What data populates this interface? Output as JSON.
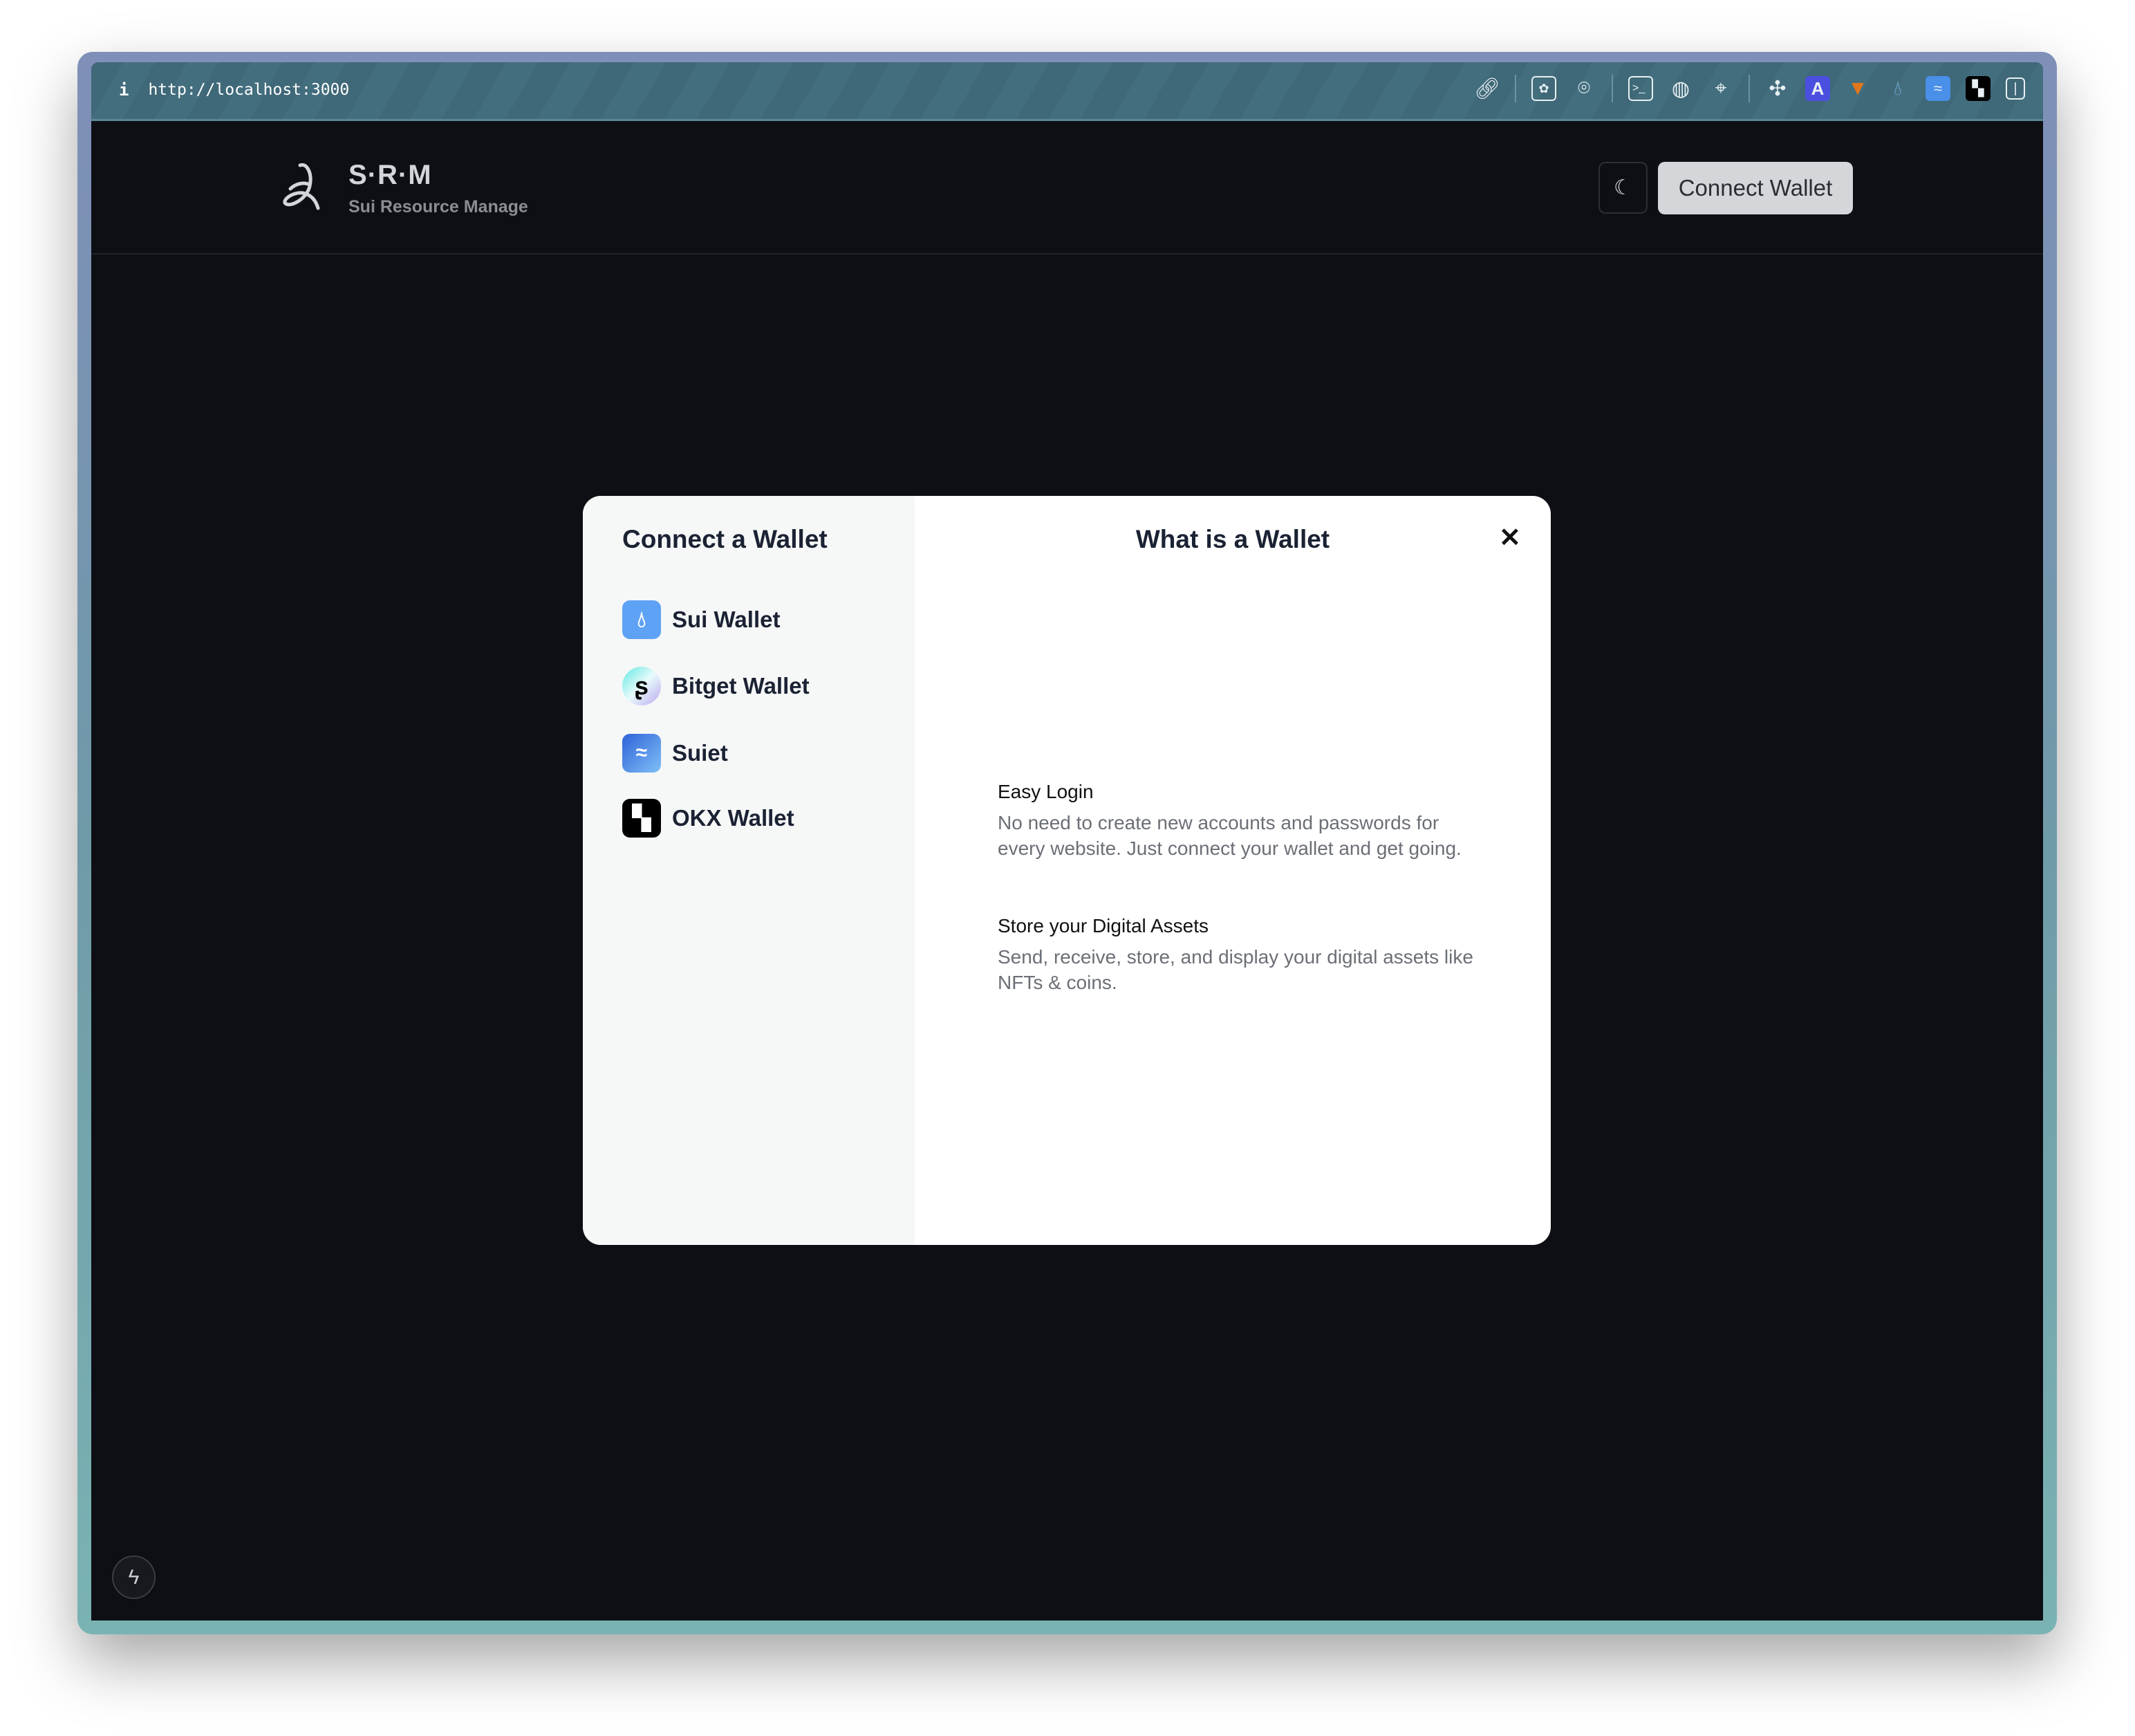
{
  "browser": {
    "info_icon": "i",
    "url": "http://localhost:3000",
    "toolbar_icons": [
      "link-icon",
      "screenshot-icon",
      "camera-icon",
      "terminal-icon",
      "globe-icon",
      "crosshair-icon",
      "extensions-icon",
      "a-extension-icon",
      "metamask-icon",
      "sui-icon",
      "suiet-icon",
      "okx-icon",
      "sidebar-icon"
    ]
  },
  "header": {
    "brand": "S·R·M",
    "subtitle": "Sui Resource Manage",
    "connect_label": "Connect Wallet"
  },
  "modal": {
    "title": "Connect a Wallet",
    "wallets": [
      {
        "name": "Sui Wallet"
      },
      {
        "name": "Bitget Wallet"
      },
      {
        "name": "Suiet"
      },
      {
        "name": "OKX Wallet"
      }
    ],
    "info_title": "What is a Wallet",
    "close": "✕",
    "sections": [
      {
        "heading": "Easy Login",
        "text": "No need to create new accounts and passwords for every website. Just connect your wallet and get going."
      },
      {
        "heading": "Store your Digital Assets",
        "text": "Send, receive, store, and display your digital assets like NFTs & coins."
      }
    ]
  }
}
